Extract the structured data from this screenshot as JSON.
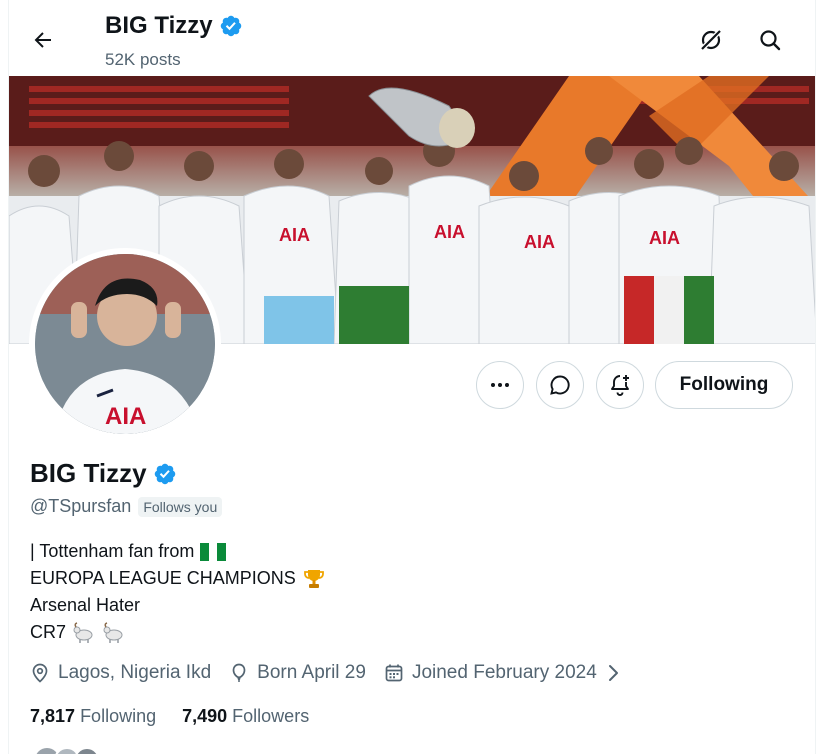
{
  "header": {
    "name": "BIG Tizzy",
    "posts": "52K posts"
  },
  "profile": {
    "name": "BIG Tizzy",
    "handle": "@TSpursfan",
    "follows_you": "Follows you",
    "bio": [
      "| Tottenham fan from",
      "EUROPA LEAGUE CHAMPIONS",
      "Arsenal Hater",
      "CR7"
    ],
    "location": "Lagos, Nigeria Ikd",
    "birthday": "Born April 29",
    "joined": "Joined February 2024"
  },
  "actions": {
    "following_label": "Following"
  },
  "stats": {
    "following_count": "7,817",
    "following_label": "Following",
    "followers_count": "7,490",
    "followers_label": "Followers"
  },
  "colors": {
    "verified": "#1d9bf0",
    "secondary_text": "#536471",
    "border": "#cfd9de"
  },
  "icons": [
    "back-arrow-icon",
    "grok-icon",
    "search-icon",
    "more-icon",
    "message-icon",
    "bell-plus-icon",
    "location-pin-icon",
    "balloon-icon",
    "calendar-icon",
    "chevron-right-icon",
    "verified-badge-icon"
  ]
}
